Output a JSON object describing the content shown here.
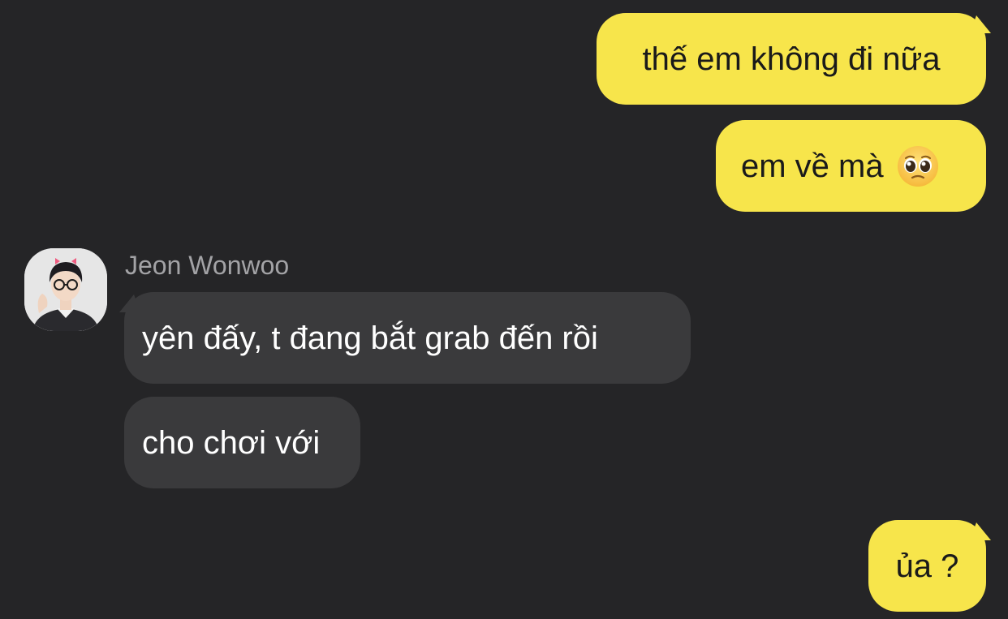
{
  "colors": {
    "background": "#252527",
    "my_bubble": "#f7e54b",
    "their_bubble": "#3a3a3c",
    "my_text": "#1a1a1a",
    "their_text": "#ffffff",
    "sender_name": "#a3a3a6"
  },
  "contact": {
    "name": "Jeon Wonwoo",
    "avatar_icon": "profile-photo"
  },
  "messages": [
    {
      "from": "me",
      "text": "thế em không đi nữa"
    },
    {
      "from": "me",
      "text": "em về mà",
      "emoji_icon": "pleading-face-emoji"
    },
    {
      "from": "contact",
      "text": "yên đấy, t đang bắt grab đến rồi"
    },
    {
      "from": "contact",
      "text": "cho chơi với"
    },
    {
      "from": "me",
      "text": "ủa ?"
    }
  ]
}
